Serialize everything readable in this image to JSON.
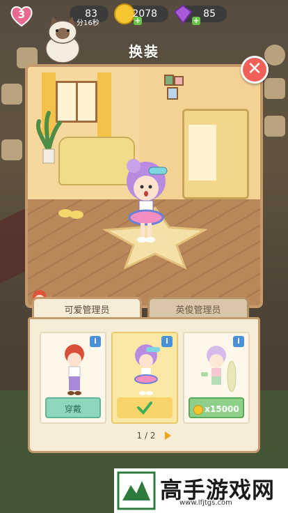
{
  "hud": {
    "level": "3",
    "count_a": "83",
    "coins": "2078",
    "gems": "85",
    "timer": "分16秒"
  },
  "modal": {
    "title": "换装",
    "close_icon": "close-x-icon"
  },
  "tabs": [
    {
      "label": "可爱管理员",
      "active": true
    },
    {
      "label": "英俊管理员",
      "active": false
    }
  ],
  "cards": [
    {
      "button": "穿戴",
      "state": "wear"
    },
    {
      "button": "",
      "state": "equipped"
    },
    {
      "button": "x15000",
      "state": "buy"
    }
  ],
  "pager": {
    "text": "1 / 2"
  },
  "watermark": {
    "text": "高手游戏网",
    "url": "www.lfjtgs.com"
  },
  "colors": {
    "accent_red": "#f2605a",
    "panel_bg": "#f7ecd8",
    "selected_card": "#fbe8a4",
    "wear_button": "#8ed6bd",
    "price_button": "#8ed08a"
  }
}
